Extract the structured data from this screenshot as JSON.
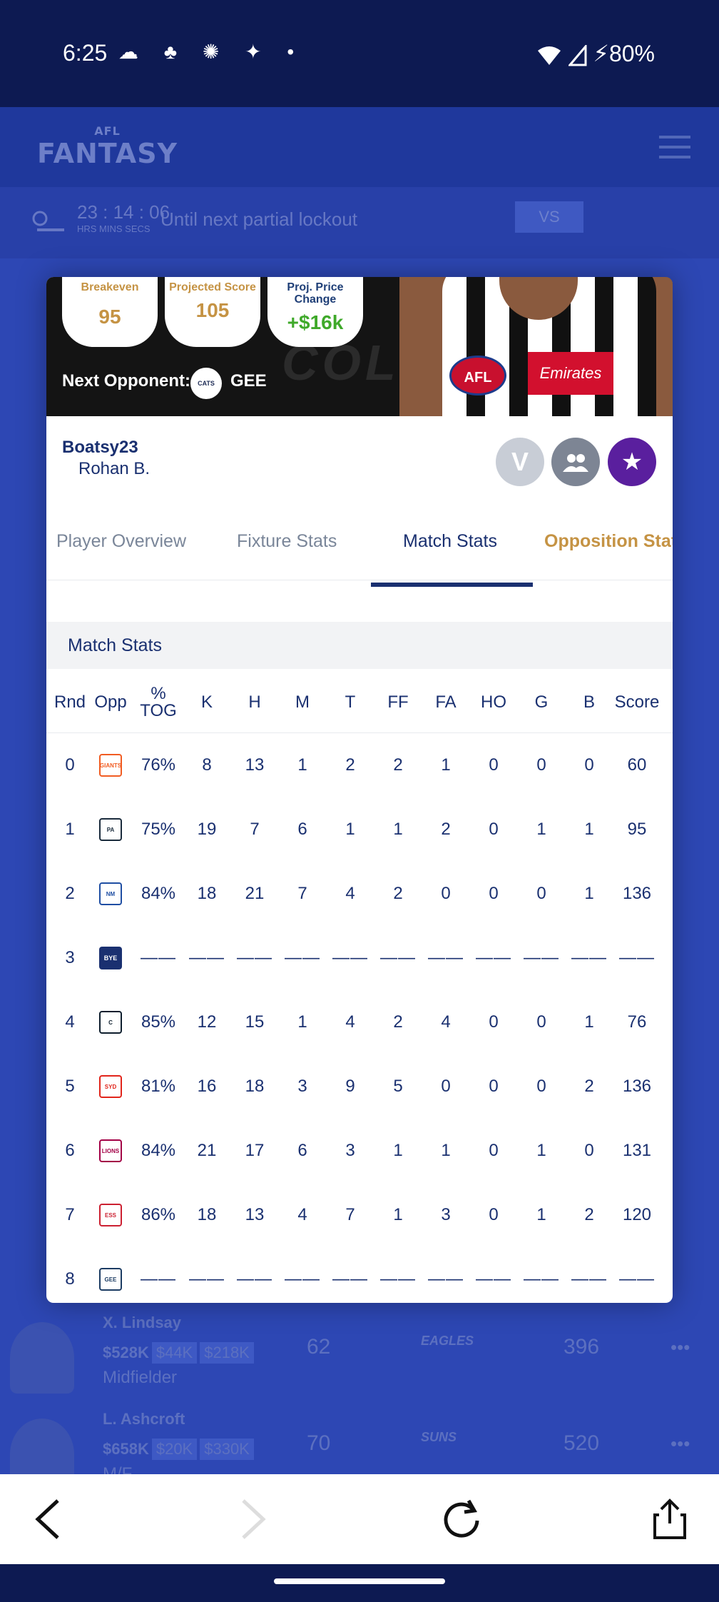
{
  "status_bar": {
    "time": "6:25",
    "notif_icons": "☁ ♣ ✺ ✦ •",
    "battery": "▼◢ ⚡80%"
  },
  "background_app": {
    "logo_small": "AFL",
    "logo": "FANTASY",
    "countdown": "23 : 14 : 06",
    "countdown_units": "HRS  MINS  SECS",
    "lockout_text": "Until next partial lockout",
    "vs_label": "VS",
    "rows": [
      {
        "name": "X. Lindsay",
        "price": "$528K",
        "badge1": "$44K",
        "badge2": "$218K",
        "position": "Midfielder",
        "avg": "62",
        "team": "EAGLES",
        "total": "396",
        "dots": "•••"
      },
      {
        "name": "L. Ashcroft",
        "price": "$658K",
        "badge1": "$20K",
        "badge2": "$330K",
        "position": "M/F",
        "avg": "70",
        "team": "SUNS",
        "total": "520",
        "dots": "•••"
      }
    ]
  },
  "player_card": {
    "breakeven_label": "Breakeven",
    "breakeven_value": "95",
    "projected_label": "Projected Score",
    "projected_value": "105",
    "price_change_label": "Proj. Price Change",
    "price_change_value": "+$16k",
    "next_opponent_label": "Next Opponent:",
    "opponent_logo_text": "CATS",
    "opponent_code": "GEE",
    "jersey_logo": "AFL",
    "jersey_sponsor": "Emirates",
    "bg_text": "COLL",
    "team_name": "Boatsy23",
    "owner_name": "Rohan B.",
    "v_label": "V",
    "group_icon": "👥",
    "star_icon": "★"
  },
  "tabs": [
    {
      "label": "Player Overview"
    },
    {
      "label": "Fixture Stats"
    },
    {
      "label": "Match Stats"
    },
    {
      "label": "Opposition Stat"
    }
  ],
  "section_title": "Match Stats",
  "table": {
    "headers": [
      "Rnd",
      "Opp",
      "% TOG",
      "K",
      "H",
      "M",
      "T",
      "FF",
      "FA",
      "HO",
      "G",
      "B",
      "Score"
    ],
    "rows": [
      {
        "rnd": "0",
        "opp": "GIANTS",
        "opp_color": "#f15c22",
        "cells": [
          "76%",
          "8",
          "13",
          "1",
          "2",
          "2",
          "1",
          "0",
          "0",
          "0",
          "60"
        ]
      },
      {
        "rnd": "1",
        "opp": "PA",
        "opp_color": "#1a2b3c",
        "cells": [
          "75%",
          "19",
          "7",
          "6",
          "1",
          "1",
          "2",
          "0",
          "1",
          "1",
          "95"
        ]
      },
      {
        "rnd": "2",
        "opp": "NM",
        "opp_color": "#1f4ea3",
        "cells": [
          "84%",
          "18",
          "21",
          "7",
          "4",
          "2",
          "0",
          "0",
          "0",
          "1",
          "136"
        ]
      },
      {
        "rnd": "3",
        "opp": "BYE",
        "opp_color": "#1a3070",
        "cells": [
          "——",
          "——",
          "——",
          "——",
          "——",
          "——",
          "——",
          "——",
          "——",
          "——",
          "——"
        ]
      },
      {
        "rnd": "4",
        "opp": "C",
        "opp_color": "#0e1e2d",
        "cells": [
          "85%",
          "12",
          "15",
          "1",
          "4",
          "2",
          "4",
          "0",
          "0",
          "1",
          "76"
        ]
      },
      {
        "rnd": "5",
        "opp": "SYD",
        "opp_color": "#e1251b",
        "cells": [
          "81%",
          "16",
          "18",
          "3",
          "9",
          "5",
          "0",
          "0",
          "0",
          "2",
          "136"
        ]
      },
      {
        "rnd": "6",
        "opp": "LIONS",
        "opp_color": "#a30046",
        "cells": [
          "84%",
          "21",
          "17",
          "6",
          "3",
          "1",
          "1",
          "0",
          "1",
          "0",
          "131"
        ]
      },
      {
        "rnd": "7",
        "opp": "ESS",
        "opp_color": "#cc2031",
        "cells": [
          "86%",
          "18",
          "13",
          "4",
          "7",
          "1",
          "3",
          "0",
          "1",
          "2",
          "120"
        ]
      },
      {
        "rnd": "8",
        "opp": "GEE",
        "opp_color": "#1c3c63",
        "cells": [
          "——",
          "——",
          "——",
          "——",
          "——",
          "——",
          "——",
          "——",
          "——",
          "——",
          "——"
        ]
      }
    ]
  },
  "browser": {
    "back": "‹",
    "forward": "›",
    "reload": "↻",
    "share": "⇪"
  }
}
